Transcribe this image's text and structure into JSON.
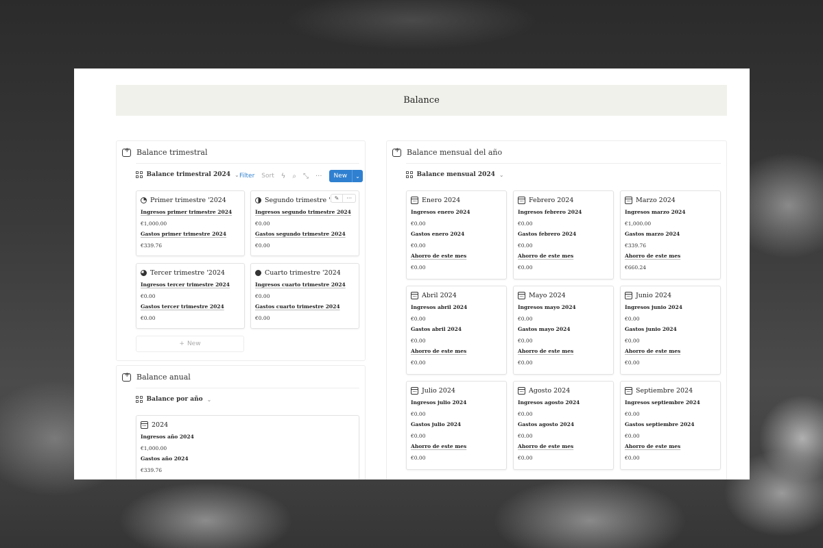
{
  "page": {
    "title": "Balance"
  },
  "trimestral": {
    "heading": "Balance trimestral",
    "view": "Balance trimestral 2024",
    "toolbar": {
      "filter": "Filter",
      "sort": "Sort",
      "new": "New"
    },
    "new_row": "New",
    "cards": [
      {
        "title": "Primer trimestre '2024",
        "in_label": "Ingresos primer trimestre 2024",
        "in_value": "€1,000.00",
        "out_label": "Gastos primer trimestre 2024",
        "out_value": "€339.76"
      },
      {
        "title": "Segundo trimestre '2024",
        "in_label": "Ingresos segundo trimestre 2024",
        "in_value": "€0.00",
        "out_label": "Gastos segundo trimestre 2024",
        "out_value": "€0.00"
      },
      {
        "title": "Tercer trimestre '2024",
        "in_label": "Ingresos tercer trimestre 2024",
        "in_value": "€0.00",
        "out_label": "Gastos tercer trimestre 2024",
        "out_value": "€0.00"
      },
      {
        "title": "Cuarto trimestre '2024",
        "in_label": "Ingresos cuarto trimestre 2024",
        "in_value": "€0.00",
        "out_label": "Gastos cuarto trimestre 2024",
        "out_value": "€0.00"
      }
    ]
  },
  "anual": {
    "heading": "Balance anual",
    "view": "Balance por año",
    "card": {
      "title": "2024",
      "in_label": "Ingresos año 2024",
      "in_value": "€1,000.00",
      "out_label": "Gastos año 2024",
      "out_value": "€339.76"
    }
  },
  "mensual": {
    "heading": "Balance mensual del año",
    "view": "Balance mensual 2024",
    "savings_label": "Ahorro de este mes",
    "months": [
      {
        "title": "Enero 2024",
        "in_label": "Ingresos enero 2024",
        "in_value": "€0.00",
        "out_label": "Gastos enero 2024",
        "out_value": "€0.00",
        "save_value": "€0.00"
      },
      {
        "title": "Febrero 2024",
        "in_label": "Ingresos febrero 2024",
        "in_value": "€0.00",
        "out_label": "Gastos febrero 2024",
        "out_value": "€0.00",
        "save_value": "€0.00"
      },
      {
        "title": "Marzo 2024",
        "in_label": "Ingresos marzo 2024",
        "in_value": "€1,000.00",
        "out_label": "Gastos marzo 2024",
        "out_value": "€339.76",
        "save_value": "€660.24"
      },
      {
        "title": "Abril 2024",
        "in_label": "Ingresos abril 2024",
        "in_value": "€0.00",
        "out_label": "Gastos abril 2024",
        "out_value": "€0.00",
        "save_value": "€0.00"
      },
      {
        "title": "Mayo 2024",
        "in_label": "Ingresos mayo 2024",
        "in_value": "€0.00",
        "out_label": "Gastos mayo 2024",
        "out_value": "€0.00",
        "save_value": "€0.00"
      },
      {
        "title": "Junio 2024",
        "in_label": "Ingresos junio 2024",
        "in_value": "€0.00",
        "out_label": "Gastos junio 2024",
        "out_value": "€0.00",
        "save_value": "€0.00"
      },
      {
        "title": "Julio 2024",
        "in_label": "Ingresos julio 2024",
        "in_value": "€0.00",
        "out_label": "Gastos julio 2024",
        "out_value": "€0.00",
        "save_value": "€0.00"
      },
      {
        "title": "Agosto 2024",
        "in_label": "Ingresos agosto 2024",
        "in_value": "€0.00",
        "out_label": "Gastos agosto 2024",
        "out_value": "€0.00",
        "save_value": "€0.00"
      },
      {
        "title": "Septiembre 2024",
        "in_label": "Ingresos septiembre 2024",
        "in_value": "€0.00",
        "out_label": "Gastos septiembre 2024",
        "out_value": "€0.00",
        "save_value": "€0.00"
      }
    ]
  },
  "colors": {
    "accent": "#2f80d0",
    "banner": "#f1f1ec"
  }
}
